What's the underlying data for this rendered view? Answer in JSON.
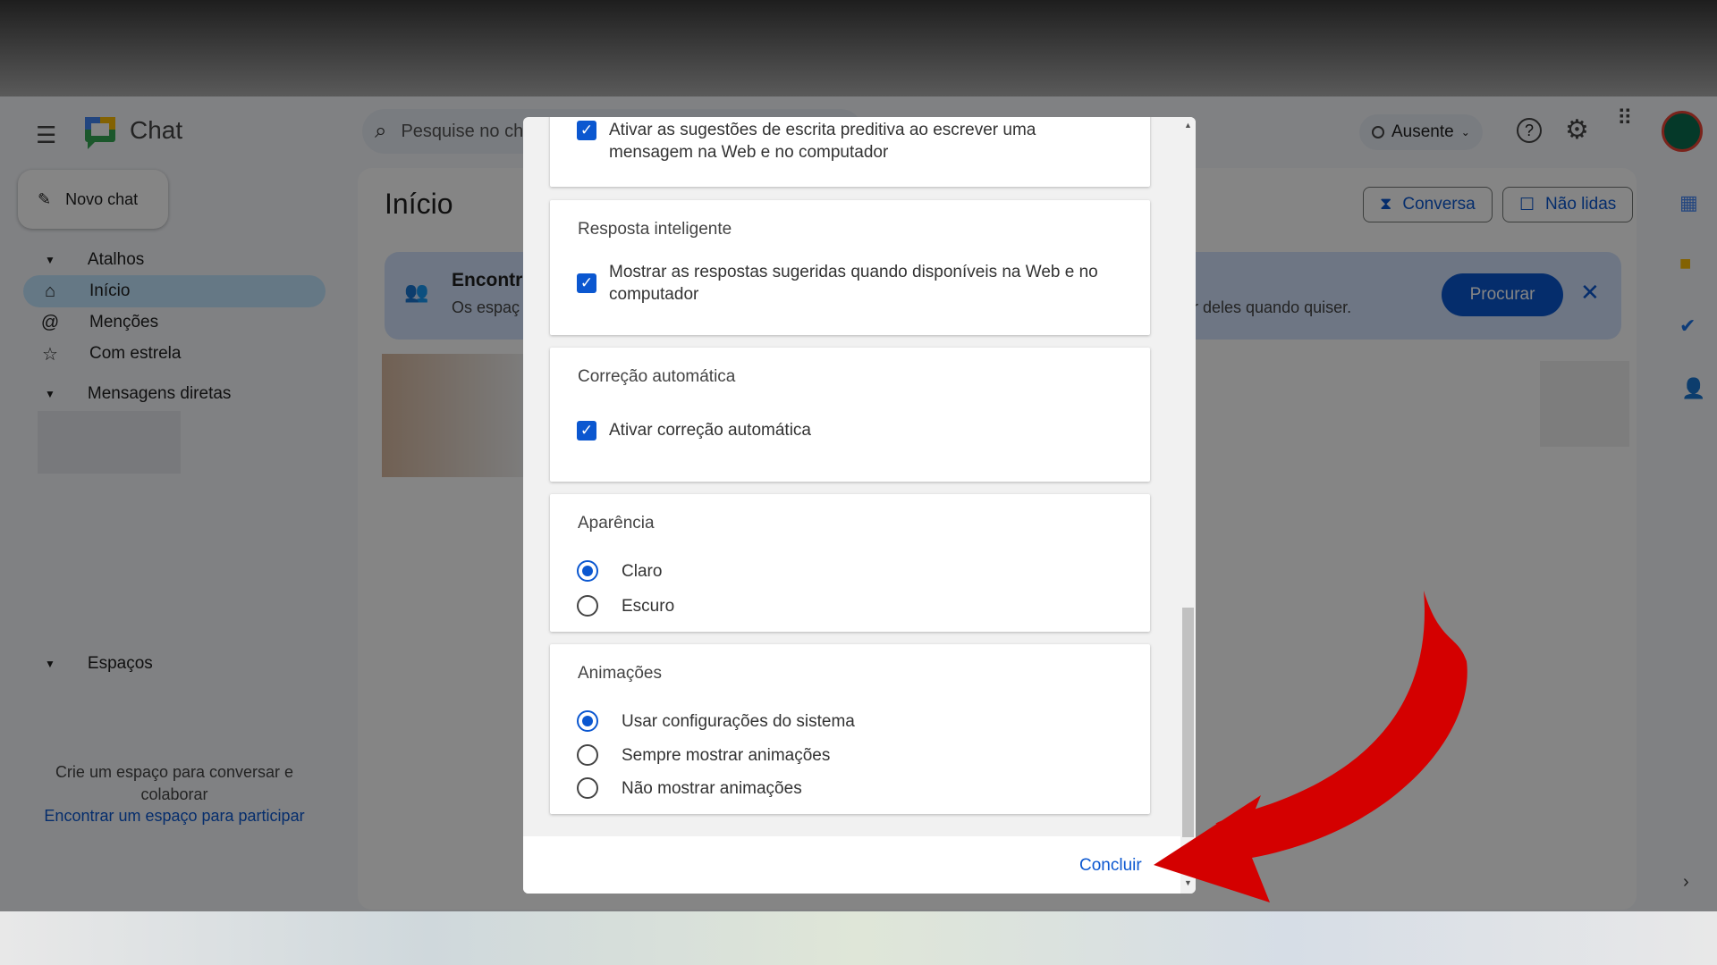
{
  "app": {
    "title": "Chat",
    "search_placeholder": "Pesquise no chat",
    "status": "Ausente",
    "new_chat": "Novo chat",
    "page_title": "Início"
  },
  "sidebar": {
    "shortcuts": "Atalhos",
    "items": [
      {
        "label": "Início",
        "icon": "home-icon"
      },
      {
        "label": "Menções",
        "icon": "at-icon"
      },
      {
        "label": "Com estrela",
        "icon": "star-icon"
      }
    ],
    "direct": "Mensagens diretas",
    "spaces": "Espaços",
    "spaces_hint": "Crie um espaço para conversar e colaborar",
    "spaces_link": "Encontrar um espaço para participar"
  },
  "header": {
    "filter_conversa": "Conversa",
    "filter_unread": "Não lidas"
  },
  "banner": {
    "title": "Encontr",
    "subtitle": "Os espaç",
    "subtitle_end": "ir deles quando quiser.",
    "button": "Procurar"
  },
  "dialog": {
    "predictive": {
      "label": "Ativar as sugestões de escrita preditiva ao escrever uma mensagem na Web e no computador",
      "checked": true
    },
    "smart_reply": {
      "title": "Resposta inteligente",
      "label": "Mostrar as respostas sugeridas quando disponíveis na Web e no computador",
      "checked": true
    },
    "autocorrect": {
      "title": "Correção automática",
      "label": "Ativar correção automática",
      "checked": true
    },
    "appearance": {
      "title": "Aparência",
      "options": [
        "Claro",
        "Escuro"
      ],
      "selected": "Claro"
    },
    "animations": {
      "title": "Animações",
      "options": [
        "Usar configurações do sistema",
        "Sempre mostrar animações",
        "Não mostrar animações"
      ],
      "selected": "Usar configurações do sistema"
    },
    "done": "Concluir"
  },
  "colors": {
    "accent": "#0b57d0",
    "arrow": "#d40000"
  }
}
